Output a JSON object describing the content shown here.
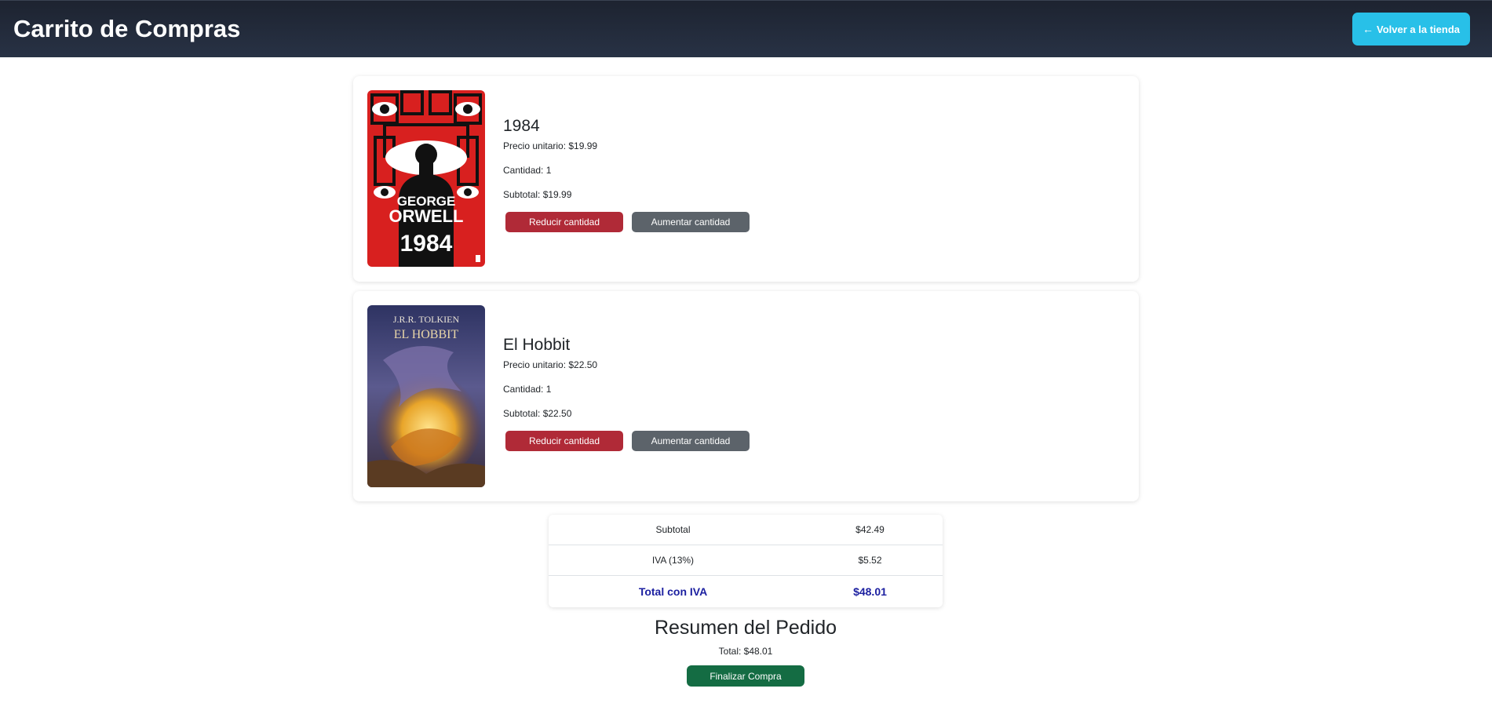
{
  "header": {
    "title": "Carrito de Compras",
    "back_button_label": "Volver a la tienda",
    "back_icon": "arrow-left-icon"
  },
  "cart": {
    "items": [
      {
        "title": "1984",
        "unit_price": "Precio unitario: $19.99",
        "quantity": "Cantidad: 1",
        "subtotal": "Subtotal: $19.99",
        "decrease_label": "Reducir cantidad",
        "increase_label": "Aumentar cantidad",
        "cover": {
          "author_line1": "GEORGE",
          "author_line2": "ORWELL",
          "title": "1984",
          "colors": {
            "background": "#d8201f",
            "figure": "#111111",
            "eye": "#ffffff"
          }
        }
      },
      {
        "title": "El Hobbit",
        "unit_price": "Precio unitario: $22.50",
        "quantity": "Cantidad: 1",
        "subtotal": "Subtotal: $22.50",
        "decrease_label": "Reducir cantidad",
        "increase_label": "Aumentar cantidad",
        "cover": {
          "author": "J.R.R. TOLKIEN",
          "title": "EL HOBBIT",
          "colors": {
            "sky": "#3b3f78",
            "dragon": "#e8a52a"
          }
        }
      }
    ]
  },
  "totals": {
    "subtotal_label": "Subtotal",
    "subtotal_value": "$42.49",
    "iva_label": "IVA (13%)",
    "iva_value": "$5.52",
    "total_label": "Total con IVA",
    "total_value": "$48.01"
  },
  "order_summary": {
    "heading": "Resumen del Pedido",
    "total_text": "Total: $48.01",
    "finish_label": "Finalizar Compra"
  },
  "colors": {
    "header_bg": "#212938",
    "back_button": "#28c0e8",
    "danger": "#b02a37",
    "secondary": "#5c636a",
    "success": "#146c43",
    "total_accent": "#1b1fa0"
  }
}
